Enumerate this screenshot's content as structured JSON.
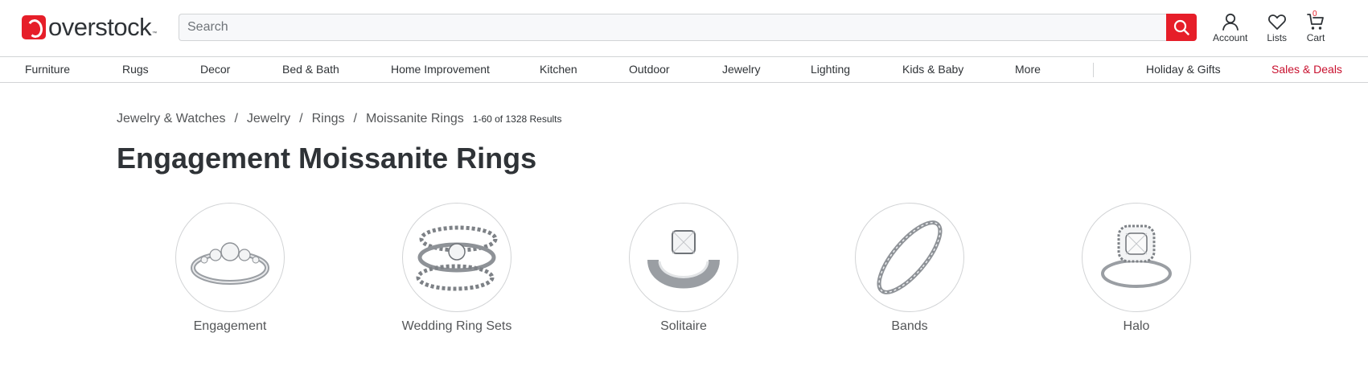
{
  "header": {
    "logo_text": "overstock",
    "logo_tm": "™",
    "search_placeholder": "Search",
    "account_label": "Account",
    "lists_label": "Lists",
    "cart_label": "Cart",
    "cart_count": "0",
    "brand_color": "#e61e29"
  },
  "nav": {
    "items": [
      "Furniture",
      "Rugs",
      "Decor",
      "Bed & Bath",
      "Home Improvement",
      "Kitchen",
      "Outdoor",
      "Jewelry",
      "Lighting",
      "Kids & Baby",
      "More"
    ],
    "holiday": "Holiday & Gifts",
    "sales": "Sales & Deals",
    "sales_color": "#c8102e"
  },
  "breadcrumb": {
    "items": [
      "Jewelry & Watches",
      "Jewelry",
      "Rings",
      "Moissanite Rings"
    ],
    "separator": "/",
    "results": "1-60 of 1328 Results"
  },
  "page_title": "Engagement Moissanite Rings",
  "categories": [
    {
      "label": "Engagement",
      "icon": "engagement-ring-image"
    },
    {
      "label": "Wedding Ring Sets",
      "icon": "wedding-ring-set-image"
    },
    {
      "label": "Solitaire",
      "icon": "solitaire-ring-image"
    },
    {
      "label": "Bands",
      "icon": "band-ring-image"
    },
    {
      "label": "Halo",
      "icon": "halo-ring-image"
    }
  ]
}
